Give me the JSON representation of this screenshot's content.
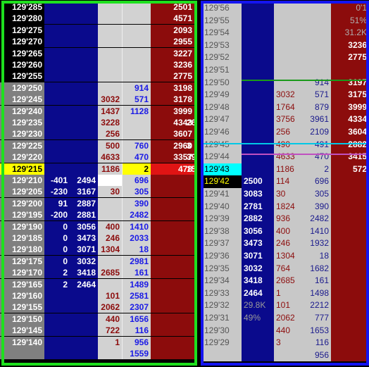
{
  "left_ladder": {
    "rows": [
      {
        "price": "129'285",
        "ask": "2501"
      },
      {
        "price": "129'280",
        "ask": "4571"
      },
      {
        "price": "129'275",
        "ask": "2093"
      },
      {
        "price": "129'270",
        "ask": "2955"
      },
      {
        "price": "129'265",
        "ask": "3227"
      },
      {
        "price": "129'260",
        "ask": "3236"
      },
      {
        "price": "129'255",
        "ask": "2775"
      },
      {
        "price": "129'250",
        "sell": "",
        "buy": "914",
        "ask": "3198"
      },
      {
        "price": "129'245",
        "sell": "3032",
        "buy": "571",
        "ask": "3178"
      },
      {
        "price": "129'240",
        "sell": "1437",
        "buy": "1128",
        "ask": "3999"
      },
      {
        "price": "129'235",
        "sell": "3228",
        "ask": "4343",
        "extra": "26"
      },
      {
        "price": "129'230",
        "sell": "256",
        "ask": "3607"
      },
      {
        "price": "129'225",
        "sell": "500",
        "buy": "760",
        "ask": "2960",
        "extra": "3"
      },
      {
        "price": "129'220",
        "sell": "4633",
        "buy": "470",
        "ask": "3357",
        "extra": "39"
      },
      {
        "price": "129'215",
        "sell": "1186",
        "buy": "2",
        "ask": "478",
        "extra": "15"
      },
      {
        "price": "129'210",
        "net": "-401",
        "bid": "2494",
        "buy": "696"
      },
      {
        "price": "129'205",
        "net": "-230",
        "bid": "3167",
        "sell": "30",
        "buy": "305"
      },
      {
        "price": "129'200",
        "net": "91",
        "bid": "2887",
        "buy": "390"
      },
      {
        "price": "129'195",
        "net": "-200",
        "bid": "2881",
        "buy": "2482"
      },
      {
        "price": "129'190",
        "net": "0",
        "bid": "3056",
        "sell": "400",
        "buy": "1410"
      },
      {
        "price": "129'185",
        "net": "0",
        "bid": "3473",
        "sell": "246",
        "buy": "2033"
      },
      {
        "price": "129'180",
        "net": "0",
        "bid": "3071",
        "sell": "1304",
        "buy": "18"
      },
      {
        "price": "129'175",
        "net": "0",
        "bid": "3032",
        "buy": "2981"
      },
      {
        "price": "129'170",
        "net": "2",
        "bid": "3418",
        "sell": "2685",
        "buy": "161"
      },
      {
        "price": "129'165",
        "net": "2",
        "bid": "2464",
        "buy": "1489"
      },
      {
        "price": "129'160",
        "sell": "101",
        "buy": "2581"
      },
      {
        "price": "129'155",
        "sell": "2062",
        "buy": "2307"
      },
      {
        "price": "129'150",
        "sell": "440",
        "buy": "1656"
      },
      {
        "price": "129'145",
        "sell": "722",
        "buy": "116"
      },
      {
        "price": "129'140",
        "sell": "1",
        "buy": "956"
      },
      {
        "price": "",
        "buy": "1559"
      }
    ]
  },
  "right_ladder": {
    "rows": [
      {
        "price": "129'56",
        "ask": "0'1"
      },
      {
        "price": "129'55",
        "ask": "51%"
      },
      {
        "price": "129'54",
        "ask": "31.2K"
      },
      {
        "price": "129'53",
        "ask": "3236"
      },
      {
        "price": "129'52",
        "ask": "2775"
      },
      {
        "price": "129'51",
        "ask": ""
      },
      {
        "price": "129'50",
        "buy": "914",
        "ask": "3197"
      },
      {
        "price": "129'49",
        "sell": "3032",
        "buy": "571",
        "ask": "3175"
      },
      {
        "price": "129'48",
        "sell": "1764",
        "buy": "879",
        "ask": "3999"
      },
      {
        "price": "129'47",
        "sell": "3756",
        "buy": "3961",
        "ask": "4334"
      },
      {
        "price": "129'46",
        "sell": "256",
        "buy": "2109",
        "ask": "3604"
      },
      {
        "price": "129'45",
        "sell": "490",
        "buy": "491",
        "ask": "2882"
      },
      {
        "price": "129'44",
        "sell": "4633",
        "buy": "470",
        "ask": "3415"
      },
      {
        "price": "129'43",
        "sell": "1186",
        "buy": "2",
        "ask": "572"
      },
      {
        "price": "129'42",
        "bid": "2500",
        "sell": "114",
        "buy": "696"
      },
      {
        "price": "129'41",
        "bid": "3083",
        "sell": "30",
        "buy": "305"
      },
      {
        "price": "129'40",
        "bid": "2781",
        "sell": "1824",
        "buy": "390"
      },
      {
        "price": "129'39",
        "bid": "2882",
        "sell": "936",
        "buy": "2482"
      },
      {
        "price": "129'38",
        "bid": "3056",
        "sell": "400",
        "buy": "1410"
      },
      {
        "price": "129'37",
        "bid": "3473",
        "sell": "246",
        "buy": "1932"
      },
      {
        "price": "129'36",
        "bid": "3071",
        "sell": "1304",
        "buy": "18"
      },
      {
        "price": "129'35",
        "bid": "3032",
        "sell": "764",
        "buy": "1682"
      },
      {
        "price": "129'34",
        "bid": "3418",
        "sell": "2685",
        "buy": "161"
      },
      {
        "price": "129'33",
        "bid": "2464",
        "sell": "1",
        "buy": "1498"
      },
      {
        "price": "129'32",
        "bid": "29.8K",
        "sell": "101",
        "buy": "2212"
      },
      {
        "price": "129'31",
        "bid": "49%",
        "sell": "2062",
        "buy": "777"
      },
      {
        "price": "129'30",
        "sell": "440",
        "buy": "1653"
      },
      {
        "price": "129'29",
        "sell": "3",
        "buy": "116"
      },
      {
        "price": "",
        "buy": "956"
      }
    ]
  },
  "colors": {
    "price_bg": "#c8c8c8",
    "price_bg_dark": "#000000",
    "bid_bg": "#0a0a8c",
    "ask_bg": "#8c0c0c",
    "highlight_yellow": "#ffff00",
    "highlight_cyan": "#00ffff",
    "frame_left": "#1ee01e",
    "frame_right": "#1414f0"
  }
}
